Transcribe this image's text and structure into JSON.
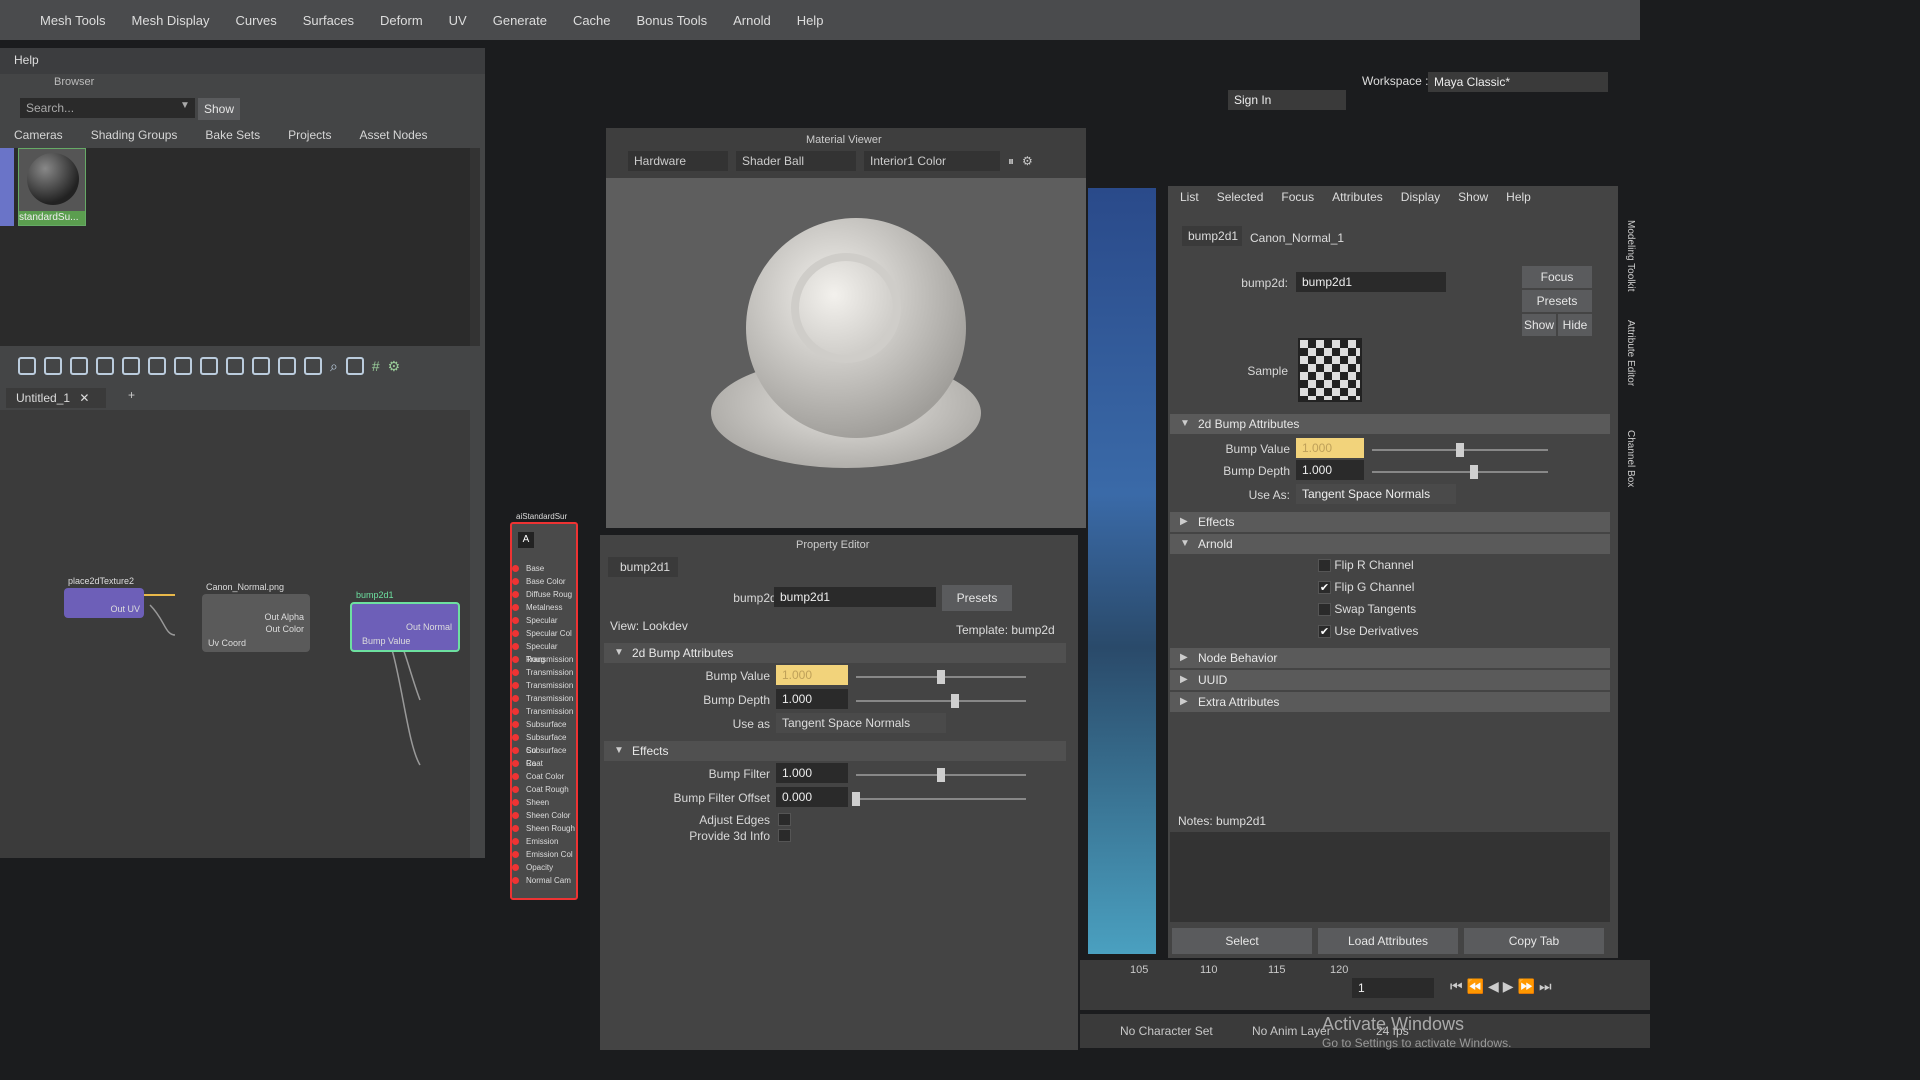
{
  "menu": [
    "Mesh Tools",
    "Mesh Display",
    "Curves",
    "Surfaces",
    "Deform",
    "UV",
    "Generate",
    "Cache",
    "Bonus Tools",
    "Arnold",
    "Help"
  ],
  "hypershade": {
    "help_label": "Help",
    "browser_title": "Browser",
    "search_placeholder": "Search...",
    "show_label": "Show",
    "tabs": [
      "Cameras",
      "Shading Groups",
      "Bake Sets",
      "Projects",
      "Asset Nodes"
    ],
    "swatch_label": "standardSu...",
    "graph_tab": "Untitled_1",
    "graph_tab_close": "✕",
    "graph_tab_add": "+",
    "nodes": {
      "place2d": {
        "title": "place2dTexture2",
        "port": "Out UV"
      },
      "canon": {
        "title": "Canon_Normal.png",
        "ports": [
          "Out Alpha",
          "Out Color",
          "Uv Coord"
        ]
      },
      "bump": {
        "title": "bump2d1",
        "ports": [
          "Out Normal",
          "Bump Value"
        ]
      },
      "standard": {
        "title": "aiStandardSur",
        "attrs": [
          "Base",
          "Base Color",
          "Diffuse Roug",
          "Metalness",
          "Specular",
          "Specular Col",
          "Specular Roug",
          "Transmission",
          "Transmission",
          "Transmission",
          "Transmission",
          "Transmission",
          "Subsurface",
          "Subsurface Co",
          "Subsurface Ra",
          "Coat",
          "Coat Color",
          "Coat Rough",
          "Sheen",
          "Sheen Color",
          "Sheen Rough",
          "Emission",
          "Emission Col",
          "Opacity",
          "Normal Cam"
        ]
      }
    }
  },
  "material_viewer": {
    "title": "Material Viewer",
    "renderer": "Hardware",
    "geometry": "Shader Ball",
    "environment": "Interior1 Color"
  },
  "property_editor": {
    "title": "Property Editor",
    "node_tab": "bump2d1",
    "node_label": "bump2d:",
    "node_value": "bump2d1",
    "presets": "Presets",
    "view": "View: Lookdev",
    "template": "Template: bump2d",
    "section_bump": "2d Bump Attributes",
    "bump_value_label": "Bump Value",
    "bump_value": "1.000",
    "bump_value_level": 0.5,
    "bump_depth_label": "Bump Depth",
    "bump_depth": "1.000",
    "bump_depth_level": 0.58,
    "use_as_label": "Use as",
    "use_as": "Tangent Space Normals",
    "section_effects": "Effects",
    "bump_filter_label": "Bump Filter",
    "bump_filter": "1.000",
    "bump_filter_level": 0.5,
    "bump_filter_offset_label": "Bump Filter Offset",
    "bump_filter_offset": "0.000",
    "bump_filter_offset_level": 0.0,
    "adjust_edges_label": "Adjust Edges",
    "provide_3d_label": "Provide 3d Info"
  },
  "top_right": {
    "workspace_label": "Workspace :",
    "workspace_value": "Maya Classic*",
    "sign_in": "Sign In"
  },
  "attribute_editor": {
    "menu": [
      "List",
      "Selected",
      "Focus",
      "Attributes",
      "Display",
      "Show",
      "Help"
    ],
    "tabs": [
      "bump2d1",
      "Canon_Normal_1"
    ],
    "node_label": "bump2d:",
    "node_value": "bump2d1",
    "focus": "Focus",
    "presets": "Presets",
    "show": "Show",
    "hide": "Hide",
    "sample_label": "Sample",
    "section_bump": "2d Bump Attributes",
    "bump_value_label": "Bump Value",
    "bump_value": "1.000",
    "bump_value_level": 0.5,
    "bump_depth_label": "Bump Depth",
    "bump_depth": "1.000",
    "bump_depth_level": 0.58,
    "use_as_label": "Use As:",
    "use_as": "Tangent Space Normals",
    "effects": "Effects",
    "arnold": "Arnold",
    "flip_r": "Flip R Channel",
    "flip_r_checked": false,
    "flip_g": "Flip G Channel",
    "flip_g_checked": true,
    "swap": "Swap Tangents",
    "swap_checked": false,
    "use_deriv": "Use Derivatives",
    "use_deriv_checked": true,
    "node_behavior": "Node Behavior",
    "uuid": "UUID",
    "extra": "Extra Attributes",
    "notes_label": "Notes: bump2d1",
    "select": "Select",
    "load": "Load Attributes",
    "copy": "Copy Tab"
  },
  "side_tabs": [
    "Modeling Toolkit",
    "Attribute Editor",
    "Channel Box"
  ],
  "timeline": {
    "ticks": [
      "105",
      "110",
      "115",
      "120"
    ],
    "current_frame": "1"
  },
  "status": {
    "character_set": "No Character Set",
    "anim_layer": "No Anim Layer",
    "fps": "24 fps",
    "activate_title": "Activate Windows",
    "activate_sub": "Go to Settings to activate Windows."
  }
}
